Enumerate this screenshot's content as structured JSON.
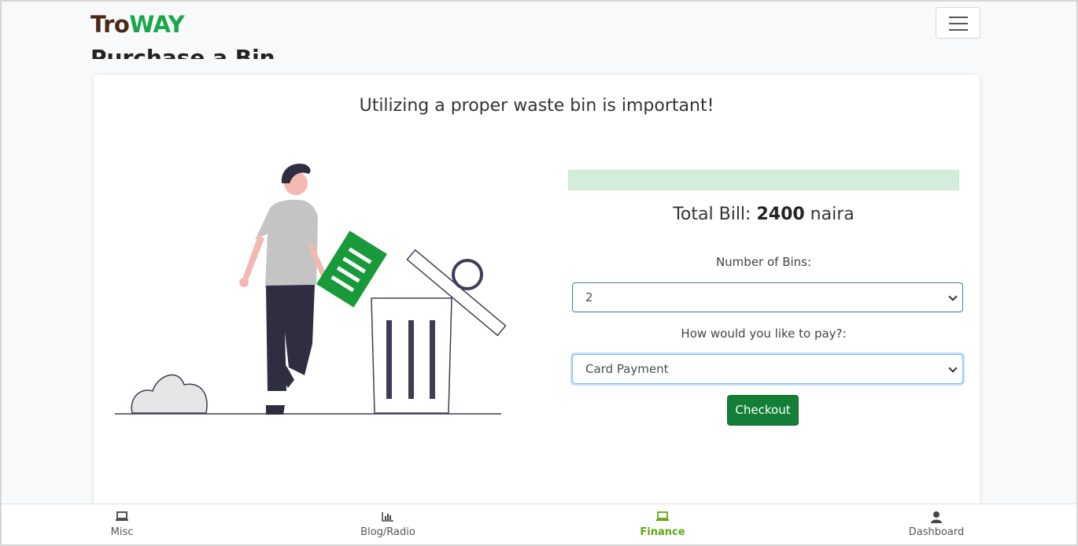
{
  "app": {
    "brand_part1": "Tro",
    "brand_part2": "WAY",
    "page_heading": "Purchase a Bin"
  },
  "card": {
    "tagline": "Utilizing a proper waste bin is important!",
    "total_prefix": "Total Bill: ",
    "total_amount": "2400",
    "total_suffix": " naira",
    "bins_label": "Number of Bins:",
    "bins_value": "2",
    "pay_label": "How would you like to pay?:",
    "pay_value": "Card Payment",
    "checkout_label": "Checkout"
  },
  "bottom_nav": [
    {
      "label": "Misc",
      "icon": "laptop-icon",
      "active": false
    },
    {
      "label": "Blog/Radio",
      "icon": "chart-bar-icon",
      "active": false
    },
    {
      "label": "Finance",
      "icon": "laptop-icon",
      "active": true
    },
    {
      "label": "Dashboard",
      "icon": "user-icon",
      "active": false
    }
  ],
  "colors": {
    "brand_dark": "#4a2a16",
    "brand_green": "#1aa64a",
    "checkout_bg": "#137f36",
    "nav_active": "#5fa814",
    "alert_bg": "#d4edda"
  }
}
